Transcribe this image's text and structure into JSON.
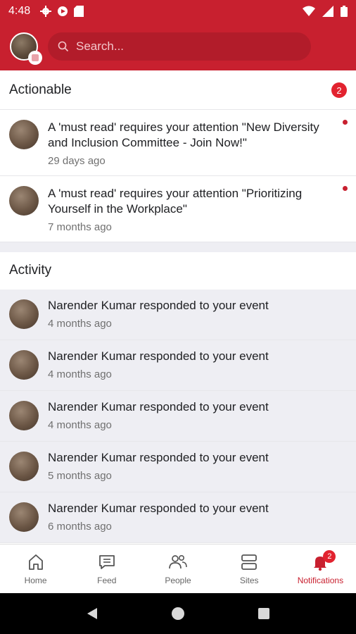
{
  "status_bar": {
    "time": "4:48"
  },
  "search": {
    "placeholder": "Search..."
  },
  "actionable": {
    "title": "Actionable",
    "count": "2",
    "items": [
      {
        "text": "A 'must read' requires your attention \"New Diversity and Inclusion Committee - Join Now!\"",
        "time": "29 days ago"
      },
      {
        "text": "A 'must read' requires your attention \"Prioritizing Yourself in the Workplace\"",
        "time": "7 months ago"
      }
    ]
  },
  "activity": {
    "title": "Activity",
    "items": [
      {
        "text": "Narender Kumar responded to your event",
        "time": "4 months ago"
      },
      {
        "text": "Narender Kumar responded to your event",
        "time": "4 months ago"
      },
      {
        "text": "Narender Kumar responded to your event",
        "time": "4 months ago"
      },
      {
        "text": "Narender Kumar responded to your event",
        "time": "5 months ago"
      },
      {
        "text": "Narender Kumar responded to your event",
        "time": "6 months ago"
      }
    ]
  },
  "bottom_nav": {
    "items": [
      {
        "label": "Home",
        "icon": "home-icon"
      },
      {
        "label": "Feed",
        "icon": "feed-icon"
      },
      {
        "label": "People",
        "icon": "people-icon"
      },
      {
        "label": "Sites",
        "icon": "sites-icon"
      },
      {
        "label": "Notifications",
        "icon": "bell-icon",
        "badge": "2"
      }
    ]
  },
  "colors": {
    "brand": "#c8202f",
    "badge": "#e2232f",
    "activity_bg": "#eeeef3"
  }
}
